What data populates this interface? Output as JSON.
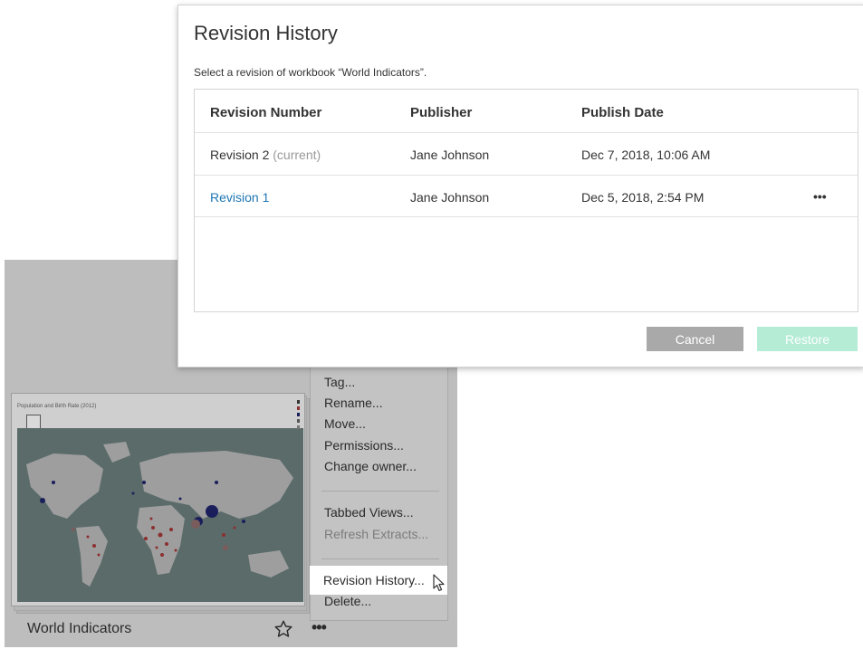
{
  "dialog": {
    "title": "Revision History",
    "subtitle": "Select a revision of workbook “World Indicators”.",
    "columns": [
      "Revision Number",
      "Publisher",
      "Publish Date"
    ],
    "rows": [
      {
        "revision": "Revision 2",
        "tag": "(current)",
        "publisher": "Jane Johnson",
        "date": "Dec 7, 2018, 10:06 AM"
      },
      {
        "revision": "Revision 1",
        "tag": "",
        "publisher": "Jane Johnson",
        "date": "Dec 5, 2018, 2:54 PM",
        "more": "•••"
      }
    ],
    "cancel_label": "Cancel",
    "restore_label": "Restore"
  },
  "workbook": {
    "name": "World Indicators",
    "thumbnail_title": "Population and Birth Rate (2012)",
    "more": "•••"
  },
  "menu": {
    "items": [
      "Tag...",
      "Rename...",
      "Move...",
      "Permissions...",
      "Change owner...",
      "Tabbed Views...",
      "Refresh Extracts...",
      "Revision History...",
      "Delete..."
    ]
  },
  "colors": {
    "link": "#1f77b4",
    "cancel": "#a9a9a9",
    "restore": "#b4ecd6",
    "map_bg": "#5b6b6a"
  },
  "icons": [
    "star-icon",
    "more-icon",
    "cursor-icon",
    "checkbox-icon"
  ]
}
